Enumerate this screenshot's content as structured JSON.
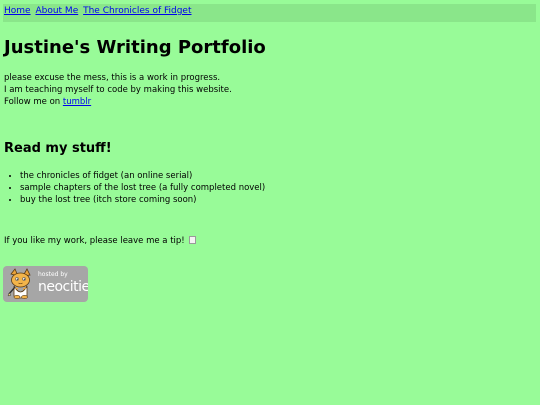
{
  "nav": {
    "home": "Home",
    "about": "About Me",
    "chronicles": "The Chronicles of Fidget"
  },
  "header": {
    "title": "Justine's Writing Portfolio"
  },
  "intro": {
    "line1": "please excuse the mess, this is a work in progress.",
    "line2": "I am teaching myself to code by making this website.",
    "line3_prefix": "Follow me on ",
    "tumblr_link": "tumblr"
  },
  "stuff": {
    "heading": "Read my stuff!",
    "items": [
      "the chronicles of fidget (an online serial)",
      "sample chapters of the lost tree (a fully completed novel)",
      "buy the lost tree (itch store coming soon)"
    ]
  },
  "tip": {
    "text": "If you like my work, please leave me a tip!",
    "image_state": "broken-image-icon"
  },
  "badge": {
    "hosted_by": "hosted by",
    "brand": "neocities",
    "icon": "neocities-cat-icon",
    "background_color": "#a6a6a6"
  },
  "colors": {
    "page_background": "#98fb98",
    "nav_background": "#8ae68a",
    "link": "#0000ee"
  }
}
